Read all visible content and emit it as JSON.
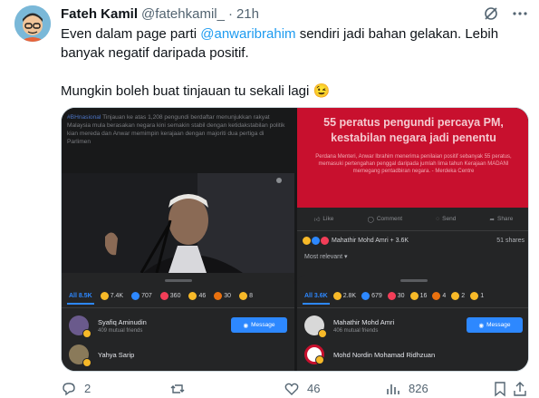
{
  "tweet": {
    "display_name": "Fateh Kamil",
    "handle": "@fatehkamil_",
    "separator": "·",
    "time": "21h",
    "text_part1": "Even dalam page parti ",
    "mention": "@anwaribrahim",
    "text_part2": " sendiri jadi bahan gelakan. Lebih banyak negatif daripada positif.",
    "text_para2": "Mungkin boleh buat tinjauan tu sekali lagi 😉"
  },
  "left_panel": {
    "caption_tag": "#BHnasional",
    "caption_text": " Tinjauan ke atas 1,208 pengundi berdaftar menunjukkan rakyat Malaysia mula berasakan negara kini semakin stabil dengan ketidakstabilan politik kian mereda dan Anwar memimpin kerajaan dengan majoriti dua pertiga di Parlimen",
    "reactions": {
      "all": "All 8.5K",
      "items": [
        {
          "emoji": "haha",
          "count": "7.4K",
          "color": "#f7b928"
        },
        {
          "emoji": "like",
          "count": "707",
          "color": "#2d88ff"
        },
        {
          "emoji": "love",
          "count": "360",
          "color": "#f33e58"
        },
        {
          "emoji": "wow",
          "count": "46",
          "color": "#f7b928"
        },
        {
          "emoji": "angry",
          "count": "30",
          "color": "#e9710f"
        },
        {
          "emoji": "care",
          "count": "8",
          "color": "#f7b928"
        }
      ]
    },
    "people": [
      {
        "name": "Syafiq Aminudin",
        "sub": "409 mutual friends",
        "button": "Message",
        "avatar_color": "#6a5a8c"
      },
      {
        "name": "Yahya Sarip",
        "sub": "",
        "avatar_color": "#8a7a5a"
      }
    ]
  },
  "right_panel": {
    "headline": "55 peratus pengundi percaya PM, kestabilan negara jadi penentu",
    "subtext": "Perdana Menteri, Anwar Ibrahim menerima penilaian positif sebanyak 55 peratus, memasuki pertengahan penggal daripada jumlah lima tahun Kerajaan MADANI memegang pentadbiran negara. - Merdeka Centre",
    "actions": [
      "Like",
      "Comment",
      "Send",
      "Share"
    ],
    "reactors": "Mahathir Mohd Amri + 3.6K",
    "shares": "51 shares",
    "most_relevant": "Most relevant",
    "reactions": {
      "all": "All 3.6K",
      "items": [
        {
          "emoji": "haha",
          "count": "2.8K",
          "color": "#f7b928"
        },
        {
          "emoji": "like",
          "count": "679",
          "color": "#2d88ff"
        },
        {
          "emoji": "love",
          "count": "30",
          "color": "#f33e58"
        },
        {
          "emoji": "wow",
          "count": "16",
          "color": "#f7b928"
        },
        {
          "emoji": "angry",
          "count": "4",
          "color": "#e9710f"
        },
        {
          "emoji": "sad",
          "count": "2",
          "color": "#f7b928"
        },
        {
          "emoji": "care",
          "count": "1",
          "color": "#f7b928"
        }
      ]
    },
    "people": [
      {
        "name": "Mahathir Mohd Amri",
        "sub": "406 mutual friends",
        "button": "Message",
        "avatar_color": "#d8d8d8"
      },
      {
        "name": "Mohd Nordin Mohamad Ridhzuan",
        "sub": "",
        "avatar_color": "#c8102e"
      }
    ]
  },
  "actions": {
    "replies": "2",
    "retweets": "",
    "likes": "46",
    "views": "826"
  },
  "colors": {
    "accent": "#1d9bf0",
    "muted": "#536471",
    "fb_blue": "#2d88ff"
  }
}
